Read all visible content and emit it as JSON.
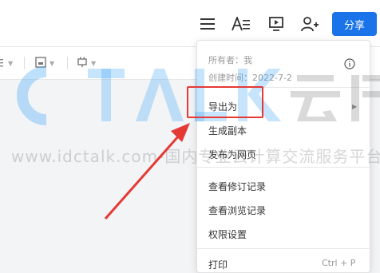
{
  "topbar": {
    "icons": [
      "menu-icon",
      "text-format-icon",
      "present-icon",
      "add-collaborator-icon"
    ],
    "share_label": "分享",
    "colors": {
      "share_button": "#1a73e8"
    }
  },
  "toolbar": {
    "icons": [
      "list-icon",
      "image-icon",
      "more-tools-icon"
    ]
  },
  "menu": {
    "owner": "所有者：我",
    "created": "创建时间：2022-7-2",
    "items": [
      {
        "label": "导出为",
        "has_submenu": true
      },
      {
        "label": "生成副本"
      },
      {
        "label": "发布为网页"
      },
      {
        "label": "查看修订记录"
      },
      {
        "label": "查看浏览记录"
      },
      {
        "label": "权限设置"
      },
      {
        "label": "打印",
        "shortcut": "Ctrl + P"
      }
    ]
  },
  "watermark": {
    "text": "www.idctalk.com-国内专业云计算交流服务平台"
  },
  "annotation": {
    "highlight_color": "#e53935"
  }
}
